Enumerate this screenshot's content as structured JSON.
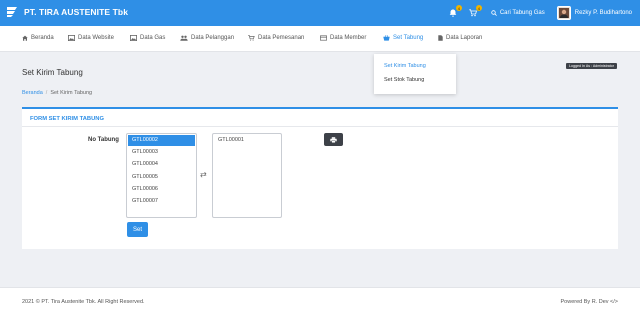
{
  "app": {
    "brand": "PT. TIRA AUSTENITE Tbk"
  },
  "topbar": {
    "notifications_count": "4",
    "cart_count": "4",
    "search_label": "Cari Tabung Gas",
    "user_name": "Rezky P. Budihartono"
  },
  "nav": {
    "items": [
      {
        "label": "Beranda",
        "icon": "home-icon"
      },
      {
        "label": "Data Website",
        "icon": "image-icon"
      },
      {
        "label": "Data Gas",
        "icon": "image-icon"
      },
      {
        "label": "Data Pelanggan",
        "icon": "users-icon"
      },
      {
        "label": "Data Pemesanan",
        "icon": "cart-icon"
      },
      {
        "label": "Data Member",
        "icon": "card-icon"
      },
      {
        "label": "Set Tabung",
        "icon": "basket-icon"
      },
      {
        "label": "Data Laporan",
        "icon": "file-icon"
      }
    ],
    "active": "Set Tabung",
    "dropdown": {
      "items": [
        "Set Kirim Tabung",
        "Set Stok Tabung"
      ],
      "active": "Set Kirim Tabung"
    }
  },
  "page": {
    "title": "Set Kirim Tabung",
    "logged_in": "Logged In As : Administrator",
    "breadcrumb": {
      "home": "Beranda",
      "sep": "/",
      "current": "Set Kirim Tabung"
    }
  },
  "form": {
    "title": "FORM SET KIRIM TABUNG",
    "field_label": "No Tabung",
    "available": [
      "GTL00002",
      "GTL00003",
      "GTL00004",
      "GTL00005",
      "GTL00006",
      "GTL00007"
    ],
    "available_selected": "GTL00002",
    "chosen": [
      "GTL00001"
    ],
    "swap_glyph": "⇄",
    "submit_label": "Set"
  },
  "footer": {
    "copyright": "2021 © PT. Tira Austenite Tbk. All Right Reserved.",
    "powered": "Powered By R. Dev </>"
  },
  "colors": {
    "primary": "#2f8fe6",
    "dark": "#3d4148",
    "bg": "#eef0f4"
  }
}
